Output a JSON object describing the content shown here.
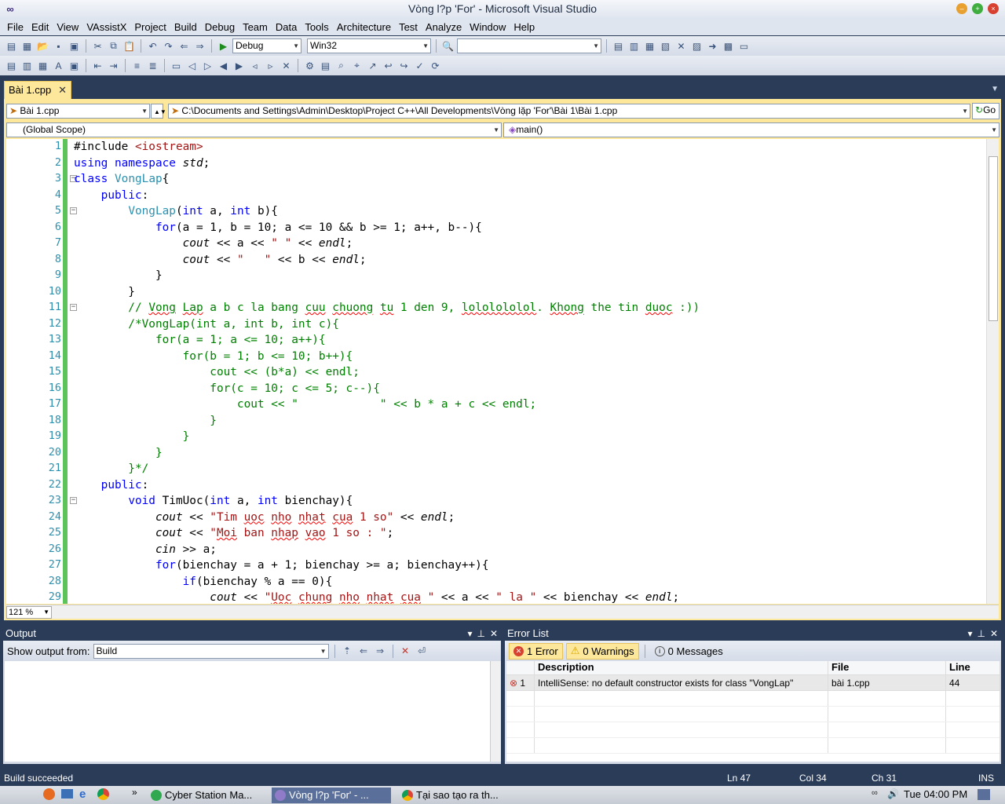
{
  "window": {
    "title": "Vòng l?p 'For' - Microsoft Visual Studio"
  },
  "menu": [
    "File",
    "Edit",
    "View",
    "VAssistX",
    "Project",
    "Build",
    "Debug",
    "Team",
    "Data",
    "Tools",
    "Architecture",
    "Test",
    "Analyze",
    "Window",
    "Help"
  ],
  "toolbar": {
    "config": "Debug",
    "platform": "Win32",
    "find_value": ""
  },
  "tab": {
    "label": "Bài 1.cpp"
  },
  "nav": {
    "file": "Bài 1.cpp",
    "path": "C:\\Documents and Settings\\Admin\\Desktop\\Project C++\\All Developments\\Vòng lặp 'For'\\Bài 1\\Bài 1.cpp",
    "go": "Go",
    "scope": "(Global Scope)",
    "member": "main()"
  },
  "editor": {
    "zoom": "121 %",
    "line_numbers": [
      "1",
      "2",
      "3",
      "4",
      "5",
      "6",
      "7",
      "8",
      "9",
      "10",
      "11",
      "12",
      "13",
      "14",
      "15",
      "16",
      "17",
      "18",
      "19",
      "20",
      "21",
      "22",
      "23",
      "24",
      "25",
      "26",
      "27",
      "28",
      "29"
    ]
  },
  "output": {
    "title": "Output",
    "show_from_label": "Show output from:",
    "source": "Build"
  },
  "errors": {
    "title": "Error List",
    "filter_errors": "1 Error",
    "filter_warnings": "0 Warnings",
    "filter_messages": "0 Messages",
    "columns": [
      "Description",
      "File",
      "Line"
    ],
    "rows": [
      {
        "num": "1",
        "description": "IntelliSense: no default constructor exists for class \"VongLap\"",
        "file": "bài 1.cpp",
        "line": "44"
      }
    ]
  },
  "status": {
    "text": "Build succeeded",
    "ln": "Ln 47",
    "col": "Col 34",
    "ch": "Ch 31",
    "mode": "INS"
  },
  "taskbar": {
    "tasks": [
      "Cyber Station Ma...",
      "Vòng l?p 'For' - ...",
      "Tại sao tạo ra th..."
    ],
    "clock": "Tue 04:00 PM"
  }
}
